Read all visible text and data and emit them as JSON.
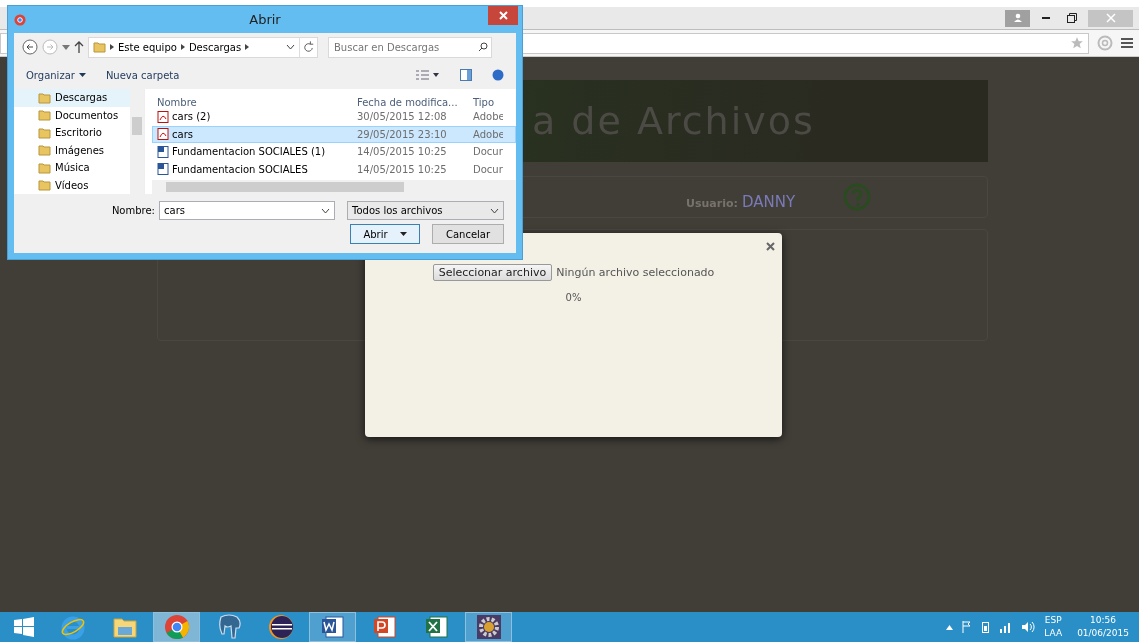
{
  "page": {
    "heading": "a de Archivos",
    "user_label": "Usuario:",
    "user_name": "DANNY"
  },
  "upload_modal": {
    "choose_button": "Seleccionar archivo",
    "file_status": "Ningún archivo seleccionado",
    "progress": "0%"
  },
  "dialog": {
    "title": "Abrir",
    "breadcrumb": [
      "Este equipo",
      "Descargas"
    ],
    "search": {
      "placeholder": "Buscar en Descargas"
    },
    "organize": "Organizar",
    "new_folder": "Nueva carpeta",
    "nav_items": [
      {
        "label": "Descargas",
        "selected": true
      },
      {
        "label": "Documentos",
        "selected": false
      },
      {
        "label": "Escritorio",
        "selected": false
      },
      {
        "label": "Imágenes",
        "selected": false
      },
      {
        "label": "Música",
        "selected": false
      },
      {
        "label": "Vídeos",
        "selected": false
      }
    ],
    "columns": [
      "Nombre",
      "Fecha de modifica...",
      "Tipo"
    ],
    "files": [
      {
        "name": "cars (2)",
        "date": "30/05/2015 12:08",
        "type": "Adobe",
        "kind": "pdf",
        "selected": false
      },
      {
        "name": "cars",
        "date": "29/05/2015 23:10",
        "type": "Adobe",
        "kind": "pdf",
        "selected": true
      },
      {
        "name": "Fundamentacion SOCIALES  (1)",
        "date": "14/05/2015 10:25",
        "type": "Docun",
        "kind": "doc",
        "selected": false
      },
      {
        "name": "Fundamentacion SOCIALES",
        "date": "14/05/2015 10:25",
        "type": "Docun",
        "kind": "doc",
        "selected": false
      }
    ],
    "filename_label": "Nombre:",
    "filename": "cars",
    "filter": "Todos los archivos",
    "open_button": "Abrir",
    "cancel_button": "Cancelar"
  },
  "taskbar": {
    "apps": [
      {
        "kind": "ie",
        "running": false,
        "selected": false
      },
      {
        "kind": "explorer",
        "running": false,
        "selected": false
      },
      {
        "kind": "chrome",
        "running": true,
        "selected": true
      },
      {
        "kind": "elephant",
        "running": false,
        "selected": false
      },
      {
        "kind": "eclipse",
        "running": false,
        "selected": false
      },
      {
        "kind": "word",
        "running": true,
        "selected": false
      },
      {
        "kind": "powerpoint",
        "running": false,
        "selected": false
      },
      {
        "kind": "excel",
        "running": false,
        "selected": false
      },
      {
        "kind": "gear",
        "running": true,
        "selected": false
      }
    ],
    "language": "ESP",
    "layout": "LAA",
    "time": "10:56",
    "date": "01/06/2015"
  }
}
